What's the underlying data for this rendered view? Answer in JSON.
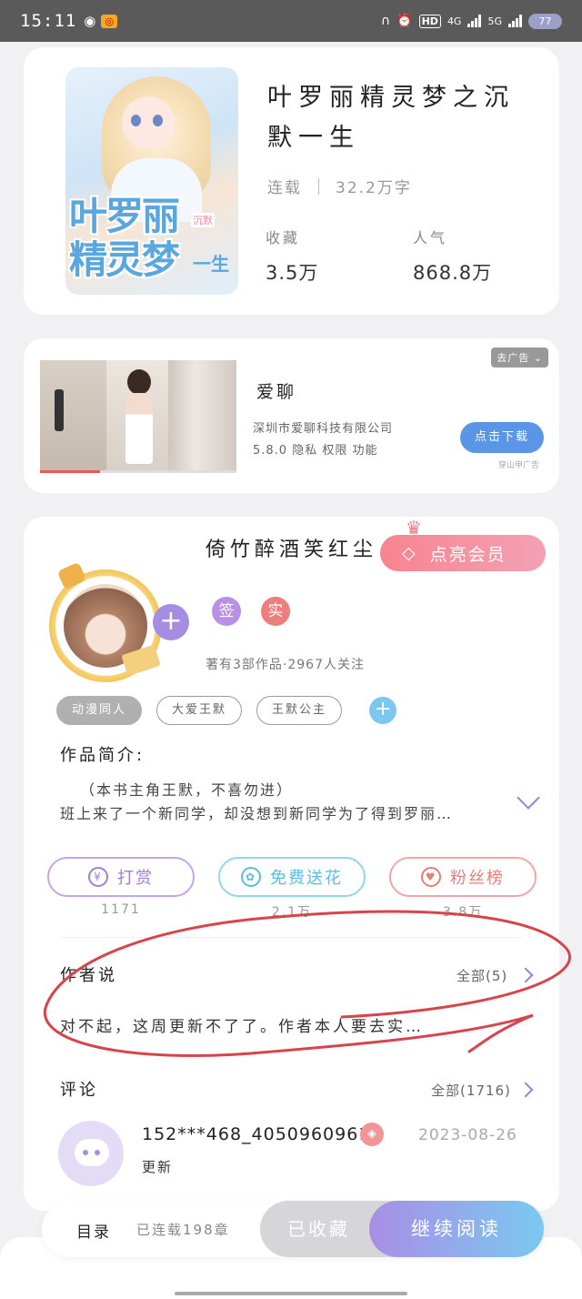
{
  "status_bar": {
    "time": "15:11",
    "net_4g": "4G",
    "net_5g": "5G",
    "hd_label": "HD",
    "battery": "77"
  },
  "book": {
    "cover_title": "叶罗丽精灵梦",
    "cover_tag": "沉默",
    "cover_sub": "一生",
    "title": "叶罗丽精灵梦之沉默一生",
    "status": "连载",
    "word_count": "32.2万字",
    "collect_label": "收藏",
    "collect_value": "3.5万",
    "popularity_label": "人气",
    "popularity_value": "868.8万"
  },
  "ad": {
    "close_label": "去广告",
    "app_name": "爱聊",
    "company": "深圳市爱聊科技有限公司",
    "version_info": "5.8.0  隐私  权限  功能",
    "download_label": "点击下载",
    "source": "穿山甲广告"
  },
  "author": {
    "name": "倚竹醉酒笑红尘",
    "vip_label": "点亮会员",
    "badge_sign": "签",
    "badge_real": "实",
    "meta": "著有3部作品·2967人关注",
    "tags": [
      "动漫同人",
      "大爱王默",
      "王默公主"
    ]
  },
  "intro": {
    "heading": "作品简介:",
    "line1": "（本书主角王默，不喜勿进）",
    "line2": "班上来了一个新同学，却没想到新同学为了得到罗丽…"
  },
  "actions": {
    "reward_label": "打赏",
    "reward_count": "1171",
    "flower_label": "免费送花",
    "flower_count": "2.1万",
    "fans_label": "粉丝榜",
    "fans_count": "3.8万"
  },
  "author_says": {
    "heading": "作者说",
    "all_label": "全部(5)",
    "text": "对不起，这周更新不了了。作者本人要去实…"
  },
  "comments": {
    "heading": "评论",
    "all_label": "全部(1716)",
    "items": [
      {
        "user": "152***468_4050960961",
        "date": "2023-08-26",
        "text": "更新"
      }
    ]
  },
  "bottom_nav": {
    "toc_label": "目录",
    "chapters_label": "已连载198章",
    "collected_label": "已收藏",
    "continue_label": "继续阅读"
  },
  "colors": {
    "accent_purple": "#a98ee6",
    "accent_blue": "#7ac9f0",
    "vip_pink": "#f8848f",
    "annotation_red": "#d8434c"
  }
}
